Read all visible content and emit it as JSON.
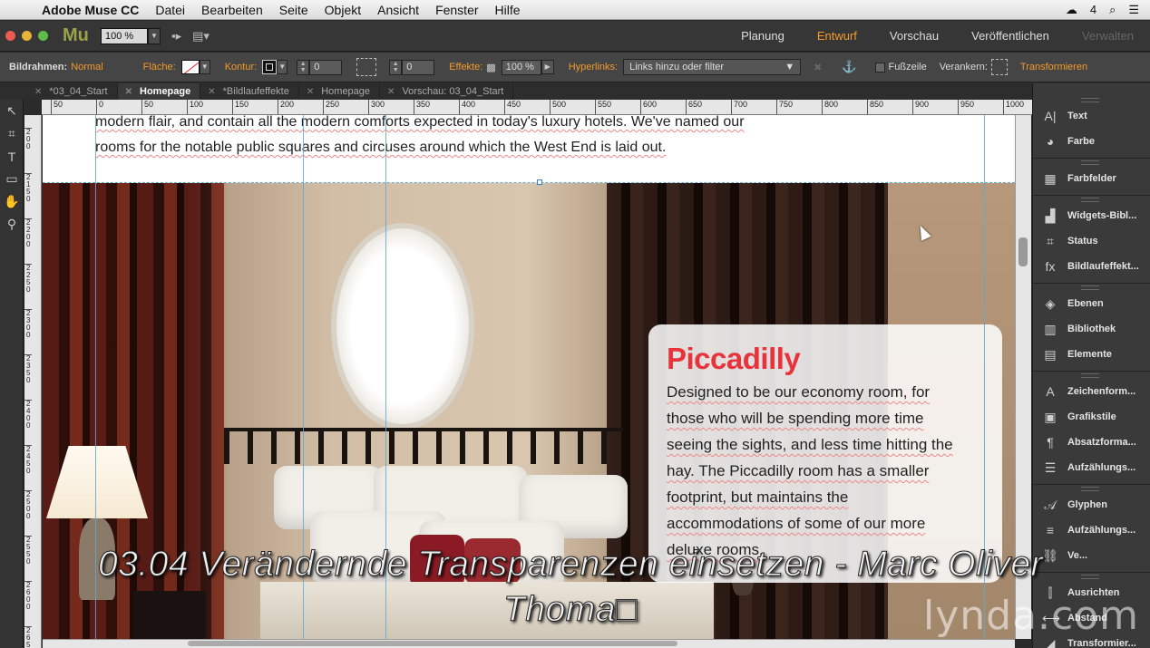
{
  "menubar": {
    "app": "Adobe Muse CC",
    "items": [
      "Datei",
      "Bearbeiten",
      "Seite",
      "Objekt",
      "Ansicht",
      "Fenster",
      "Hilfe"
    ],
    "badge_count": "4"
  },
  "appbar": {
    "logo": "Mu",
    "zoom": "100 %",
    "modes": [
      "Planung",
      "Entwurf",
      "Vorschau",
      "Veröffentlichen",
      "Verwalten"
    ],
    "active_mode": "Entwurf"
  },
  "controlbar": {
    "frame_label": "Bildrahmen:",
    "frame_value": "Normal",
    "fill_label": "Fläche:",
    "stroke_label": "Kontur:",
    "stroke_width": "0",
    "corner_radius": "0",
    "effects_label": "Effekte:",
    "opacity": "100 %",
    "hyperlinks_label": "Hyperlinks:",
    "hyperlinks_placeholder": "Links hinzu oder filter",
    "footer_label": "Fußzeile",
    "anchor_label": "Verankern:",
    "transform_label": "Transformieren"
  },
  "tabs": [
    {
      "label": "*03_04_Start",
      "active": false
    },
    {
      "label": "Homepage",
      "active": true
    },
    {
      "label": "*Bildlaufeffekte",
      "active": false
    },
    {
      "label": "Homepage",
      "active": false
    },
    {
      "label": "Vorschau: 03_04_Start",
      "active": false
    }
  ],
  "ruler_top": [
    "50",
    "0",
    "50",
    "100",
    "150",
    "200",
    "250",
    "300",
    "350",
    "400",
    "450",
    "500",
    "550",
    "600",
    "650",
    "700",
    "750",
    "800",
    "850",
    "900",
    "950",
    "1000"
  ],
  "ruler_left": [
    "200",
    "2150",
    "2200",
    "2250",
    "2300",
    "2350",
    "2400",
    "2450",
    "2500",
    "2550",
    "2600",
    "2650"
  ],
  "page": {
    "top_text_lines": [
      "modern flair, and contain all the modern comforts expected in today's luxury hotels. We've named our",
      "rooms for the notable public squares and circuses around which the West End is laid out."
    ],
    "box_title": "Piccadilly",
    "box_lines": [
      "Designed to be our economy room, for",
      "those who will be spending more time",
      "seeing the sights, and less time hitting the",
      "hay. The Piccadilly room has a smaller",
      "footprint, but maintains the",
      "accommodations of some of our more",
      "deluxe rooms."
    ]
  },
  "panel": {
    "groups": [
      [
        {
          "icon": "text-icon",
          "glyph": "A|",
          "label": "Text"
        },
        {
          "icon": "color-icon",
          "glyph": "◕",
          "label": "Farbe"
        }
      ],
      [
        {
          "icon": "swatches-icon",
          "glyph": "▦",
          "label": "Farbfelder"
        }
      ],
      [
        {
          "icon": "widgets-icon",
          "glyph": "▟",
          "label": "Widgets-Bibl..."
        },
        {
          "icon": "status-icon",
          "glyph": "⌗",
          "label": "Status"
        },
        {
          "icon": "fx-icon",
          "glyph": "fx",
          "label": "Bildlaufeffekt..."
        }
      ],
      [
        {
          "icon": "layers-icon",
          "glyph": "◈",
          "label": "Ebenen"
        },
        {
          "icon": "library-icon",
          "glyph": "▥",
          "label": "Bibliothek"
        },
        {
          "icon": "assets-icon",
          "glyph": "▤",
          "label": "Elemente"
        }
      ],
      [
        {
          "icon": "char-format-icon",
          "glyph": "A",
          "label": "Zeichenform..."
        },
        {
          "icon": "graphic-styles-icon",
          "glyph": "▣",
          "label": "Grafikstile"
        },
        {
          "icon": "paragraph-icon",
          "glyph": "¶",
          "label": "Absatzforma..."
        },
        {
          "icon": "bullets-icon",
          "glyph": "☰",
          "label": "Aufzählungs..."
        }
      ],
      [
        {
          "icon": "glyphs-icon",
          "glyph": "𝒜",
          "label": "Glyphen"
        },
        {
          "icon": "list-icon",
          "glyph": "≡",
          "label": "Aufzählungs..."
        },
        {
          "icon": "links-icon",
          "glyph": "⛓",
          "label": "Ve..."
        }
      ],
      [
        {
          "icon": "align-icon",
          "glyph": "⫿",
          "label": "Ausrichten"
        },
        {
          "icon": "spacing-icon",
          "glyph": "⟷",
          "label": "Abstand"
        },
        {
          "icon": "transform-icon",
          "glyph": "◢",
          "label": "Transformier..."
        }
      ]
    ]
  },
  "overlay": {
    "subtitle_line1": "03.04 Verändernde Transparenzen einsetzen - Marc Oliver",
    "subtitle_line2": "Thoma□",
    "watermark": "lynda.com"
  },
  "colors": {
    "accent": "#f39a2b",
    "title_red": "#e8333d",
    "guide": "#5ea9d6"
  }
}
